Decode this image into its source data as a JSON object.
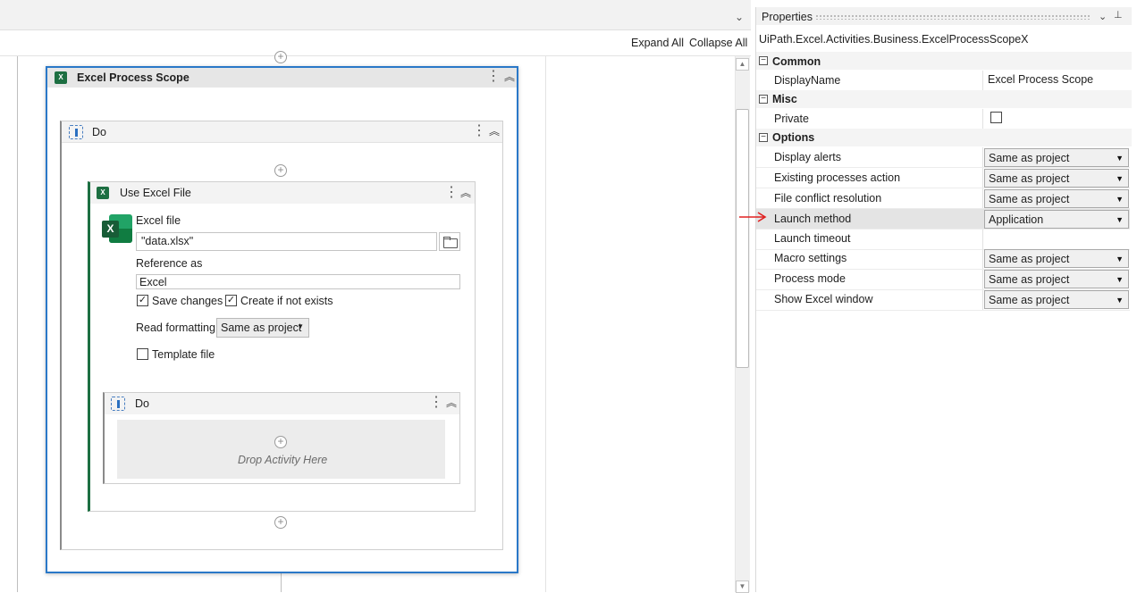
{
  "designer": {
    "expand_all": "Expand All",
    "collapse_all": "Collapse All",
    "excel_process_scope": {
      "title": "Excel Process Scope",
      "do_title": "Do"
    },
    "use_excel_file": {
      "title": "Use Excel File",
      "excel_file_label": "Excel file",
      "excel_file_value": "\"data.xlsx\"",
      "reference_as_label": "Reference as",
      "reference_as_value": "Excel",
      "save_changes_label": "Save changes",
      "save_changes_checked": true,
      "create_if_not_exists_label": "Create if not exists",
      "create_if_not_exists_checked": true,
      "read_formatting_label": "Read formatting",
      "read_formatting_value": "Same as project",
      "template_file_label": "Template file",
      "template_file_checked": false,
      "inner_do_title": "Do",
      "drop_text": "Drop Activity Here"
    }
  },
  "properties": {
    "title": "Properties",
    "type_name": "UiPath.Excel.Activities.Business.ExcelProcessScopeX",
    "categories": [
      {
        "name": "Common",
        "rows": [
          {
            "name": "DisplayName",
            "value": "Excel Process Scope"
          }
        ]
      },
      {
        "name": "Misc",
        "rows": [
          {
            "name": "Private",
            "checked": false
          }
        ]
      },
      {
        "name": "Options",
        "rows": [
          {
            "name": "Display alerts",
            "value": "Same as project"
          },
          {
            "name": "Existing processes action",
            "value": "Same as project"
          },
          {
            "name": "File conflict resolution",
            "value": "Same as project"
          },
          {
            "name": "Launch method",
            "value": "Application"
          },
          {
            "name": "Launch timeout",
            "value": ""
          },
          {
            "name": "Macro settings",
            "value": "Same as project"
          },
          {
            "name": "Process mode",
            "value": "Same as project"
          },
          {
            "name": "Show Excel window",
            "value": "Same as project"
          }
        ]
      }
    ]
  },
  "colors": {
    "selection_border": "#2a78c8",
    "excel_green": "#1d6f42",
    "annotation_arrow": "#e02020"
  }
}
